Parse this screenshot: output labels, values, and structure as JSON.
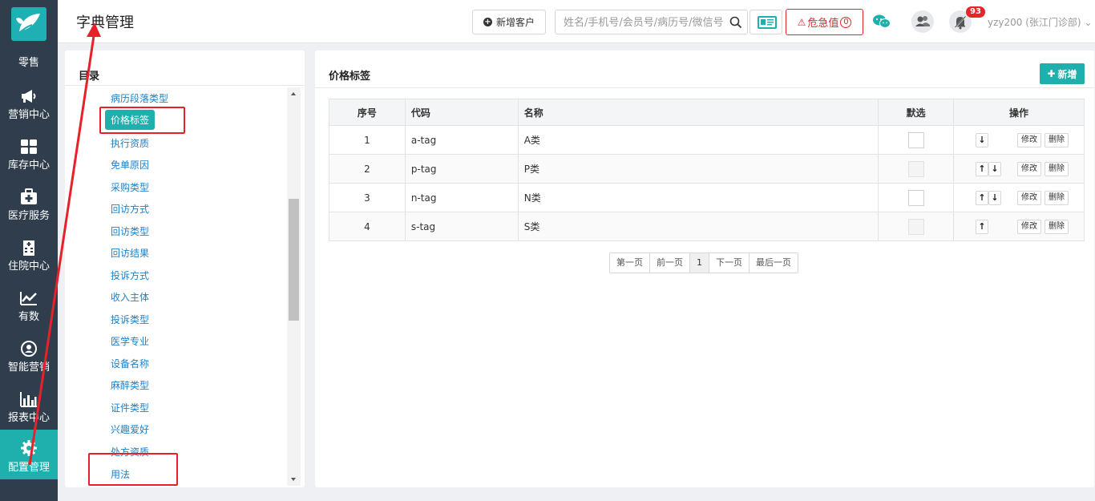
{
  "sidebar": {
    "items": [
      {
        "label": "零售",
        "icon": "retail-icon"
      },
      {
        "label": "营销中心",
        "icon": "megaphone-icon"
      },
      {
        "label": "库存中心",
        "icon": "grid-icon"
      },
      {
        "label": "医疗服务",
        "icon": "medical-kit-icon"
      },
      {
        "label": "住院中心",
        "icon": "hospital-building-icon"
      },
      {
        "label": "有数",
        "icon": "trend-chart-icon"
      },
      {
        "label": "智能营销",
        "icon": "smart-marketing-icon"
      },
      {
        "label": "报表中心",
        "icon": "bar-chart-icon"
      },
      {
        "label": "配置管理",
        "icon": "gear-icon"
      }
    ],
    "active_index": 8,
    "colors": {
      "bg": "#2f3d4c",
      "active": "#1fb0ad"
    }
  },
  "header": {
    "title": "字典管理",
    "add_customer_label": "新增客户",
    "search_placeholder": "姓名/手机号/会员号/病历号/微信号",
    "critical_label": "危急值",
    "critical_count": "0",
    "notification_count": "93",
    "user_label": "yzy200 (张江门诊部)"
  },
  "tree": {
    "title": "目录",
    "items": [
      "病历段落类型",
      "价格标签",
      "执行资质",
      "免单原因",
      "采购类型",
      "回访方式",
      "回访类型",
      "回访结果",
      "投诉方式",
      "收入主体",
      "投诉类型",
      "医学专业",
      "设备名称",
      "麻醉类型",
      "证件类型",
      "兴趣爱好",
      "处方资质",
      "用法"
    ],
    "selected_index": 1
  },
  "main": {
    "title": "价格标签",
    "new_button_label": "新增",
    "columns": [
      "序号",
      "代码",
      "名称",
      "默选",
      "操作"
    ],
    "rows": [
      {
        "index": "1",
        "code": "a-tag",
        "name": "A类",
        "up": false,
        "down": true
      },
      {
        "index": "2",
        "code": "p-tag",
        "name": "P类",
        "up": true,
        "down": true
      },
      {
        "index": "3",
        "code": "n-tag",
        "name": "N类",
        "up": true,
        "down": true
      },
      {
        "index": "4",
        "code": "s-tag",
        "name": "S类",
        "up": true,
        "down": false
      }
    ],
    "edit_label": "修改",
    "delete_label": "删除",
    "pager": {
      "first": "第一页",
      "prev": "前一页",
      "current": "1",
      "next": "下一页",
      "last": "最后一页"
    }
  },
  "colors": {
    "accent": "#1fb0ad",
    "danger": "#e2262b",
    "link": "#1f7fc4"
  }
}
